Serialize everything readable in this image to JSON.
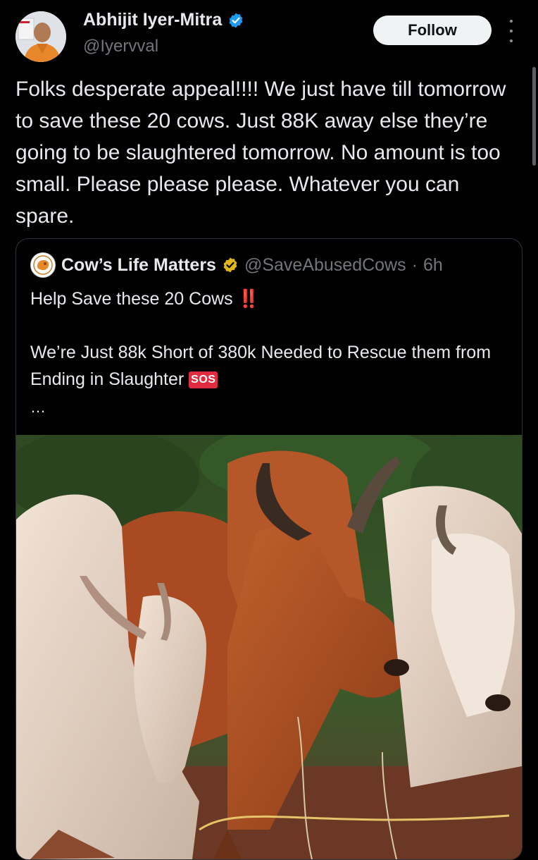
{
  "author": {
    "name": "Abhijit Iyer-Mitra",
    "handle": "@Iyervval",
    "verified": true,
    "verified_color": "#1d9bf0"
  },
  "follow_label": "Follow",
  "tweet_text": "Folks desperate appeal!!!! We just have till tomorrow to save these 20 cows. Just 88K away else they’re going to be slaughtered tomorrow. No amount is too small. Please please please. Whatever you can spare.",
  "quote": {
    "name": "Cow’s Life Matters",
    "handle": "@SaveAbusedCows",
    "separator": "·",
    "time": "6h",
    "verified_color": "#e2b719",
    "line1": "Help Save these 20 Cows",
    "line1_emoji": "‼️",
    "line2": "We’re Just 88k Short of 380k Needed to Rescue them from Ending in Slaughter",
    "sos_label": "SOS",
    "ellipsis": "…"
  },
  "icons": {
    "verified": "verified-check-icon",
    "more": "more-vertical-icon"
  }
}
